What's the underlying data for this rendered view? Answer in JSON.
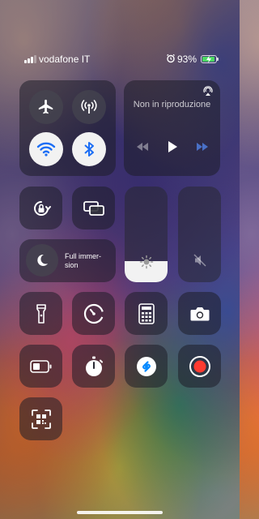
{
  "status_bar": {
    "carrier": "vodafone IT",
    "battery_percent": "93%",
    "signal_bars": 3,
    "alarm_icon": "alarm-clock-icon",
    "charging": true,
    "battery_level": 0.93,
    "battery_color": "#4cd964"
  },
  "connectivity": {
    "airplane_mode": {
      "icon": "airplane-icon",
      "on": false
    },
    "cellular_data": {
      "icon": "antenna-icon",
      "on": false
    },
    "wifi": {
      "icon": "wifi-icon",
      "on": true
    },
    "bluetooth": {
      "icon": "bluetooth-icon",
      "on": true
    }
  },
  "now_playing": {
    "title": "Non in riproduzione",
    "icons": [
      "airplay-icon",
      "rewind-icon",
      "play-icon",
      "fast-forward-icon"
    ]
  },
  "orientation_lock": {
    "icon": "rotation-lock-icon"
  },
  "screen_mirroring": {
    "icon": "screen-mirroring-icon"
  },
  "focus": {
    "icon": "moon-icon",
    "label": "Full immer-sion"
  },
  "brightness": {
    "icon": "sun-icon",
    "level": 0.22
  },
  "volume": {
    "icon": "speaker-muted-icon",
    "level": 0
  },
  "shortcuts": [
    {
      "icon": "flashlight-icon"
    },
    {
      "icon": "timer-icon"
    },
    {
      "icon": "calculator-icon"
    },
    {
      "icon": "camera-icon"
    },
    {
      "icon": "low-power-battery-icon"
    },
    {
      "icon": "stopwatch-icon"
    },
    {
      "icon": "shazam-icon"
    },
    {
      "icon": "screen-record-icon"
    },
    {
      "icon": "qr-code-scanner-icon"
    }
  ],
  "colors": {
    "active_tile": "#f2f2f2",
    "active_icon": "#1c6ef5",
    "recording_red": "#ff3b30",
    "shazam_blue": "#0088ff"
  }
}
